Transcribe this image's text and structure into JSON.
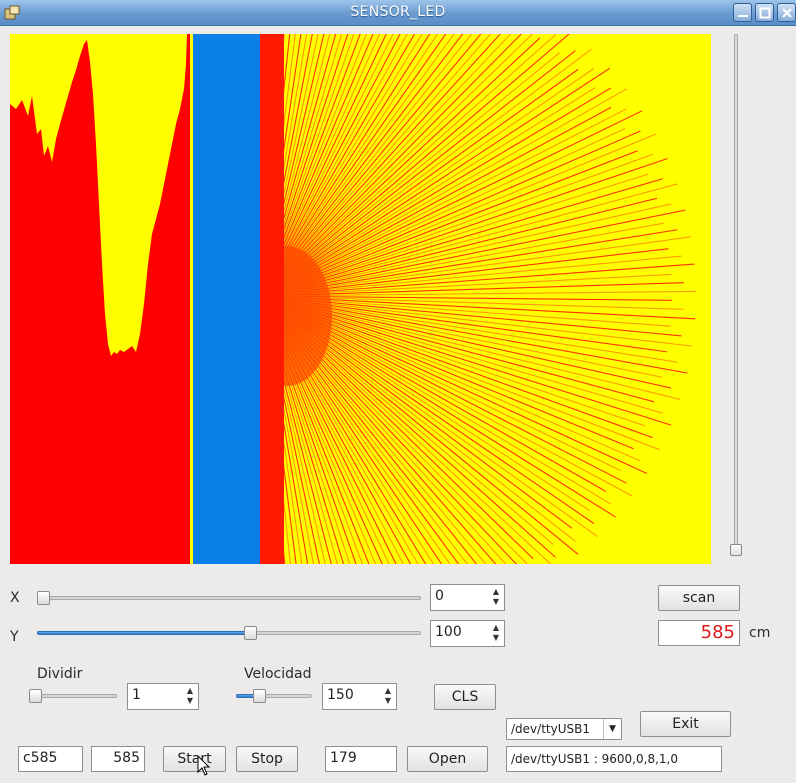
{
  "window": {
    "title": "SENSOR_LED",
    "icon": "app-icon",
    "controls": [
      "minimize-icon",
      "maximize-icon",
      "close-icon"
    ]
  },
  "colors": {
    "background": "#ffff00",
    "plot_red": "#ff0000",
    "plot_orange": "#ff9900",
    "band_blue": "#0a7fe8",
    "readout": "#e01818"
  },
  "controls": {
    "x_label": "X",
    "y_label": "Y",
    "x_value": "0",
    "y_value": "100",
    "x_slider_fraction": 0,
    "y_slider_fraction": 0.56,
    "dividir_label": "Dividir",
    "dividir_value": "1",
    "dividir_slider_fraction": 0,
    "velocidad_label": "Velocidad",
    "velocidad_value": "150",
    "velocidad_slider_fraction": 0.3,
    "vertical_slider_fraction": 1
  },
  "buttons": {
    "scan": "scan",
    "cls": "CLS",
    "exit": "Exit",
    "start": "Start",
    "stop": "Stop",
    "open": "Open"
  },
  "readout": {
    "value": "585",
    "unit": "cm"
  },
  "bottom": {
    "command": "c585",
    "distance": "585",
    "count": "179",
    "port_selected": "/dev/ttyUSB1",
    "port_settings": "/dev/ttyUSB1 : 9600,0,8,1,0"
  }
}
